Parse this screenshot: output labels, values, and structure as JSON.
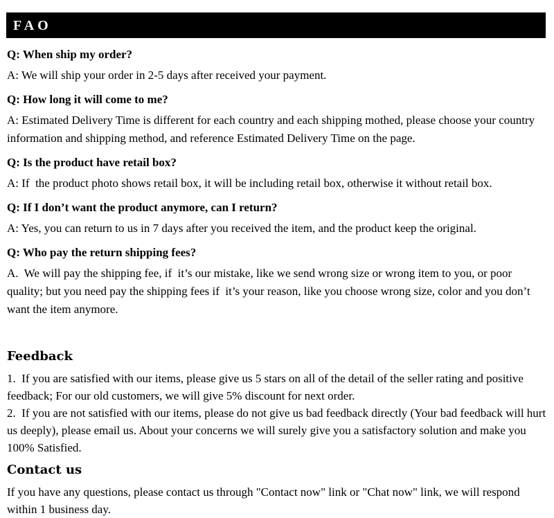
{
  "header": {
    "title": "FAO",
    "background_color": "#000000",
    "text_color": "#ffffff"
  },
  "faq": {
    "items": [
      {
        "question": "Q: When ship my order?",
        "answer": "A: We will ship your order in 2-5 days after received your payment."
      },
      {
        "question": "Q: How long it will come to me?",
        "answer": "A: Estimated Delivery Time is different for each country and each shipping mothed, please choose your country information and shipping method, and reference Estimated Delivery Time on the page."
      },
      {
        "question": "Q: Is the product have retail box?",
        "answer": "A: If  the product photo shows retail box, it will be including retail box, otherwise it without retail box."
      },
      {
        "question": "Q: If I don’t want the product anymore, can I return?",
        "answer": "A: Yes, you can return to us in 7 days after you received the item, and the product keep the original."
      },
      {
        "question": "Q: Who pay the return shipping fees?",
        "answer": "A.  We will pay the shipping fee, if  it’s our mistake, like we send wrong size or wrong item to you, or poor quality; but you need pay the shipping fees if  it’s your reason, like you choose wrong size, color and you don’t want the item anymore."
      }
    ]
  },
  "feedback": {
    "title": "Feedback",
    "point_1": "1.  If you are satisfied with our items, please give us 5 stars on all of the detail of the seller rating and positive feedback; For our old customers, we will give 5% discount for next order.",
    "point_2": "2.  If you are not satisfied with our items, please do not give us bad feedback directly (Your bad feedback will hurt us deeply), please email us. About your concerns we will surely give you a satisfactory solution and make you 100% Satisfied."
  },
  "contact": {
    "title": "Contact us",
    "body": "If you have any questions, please contact us through \"Contact now\" link or \"Chat now\" link, we will respond within 1 business day."
  }
}
